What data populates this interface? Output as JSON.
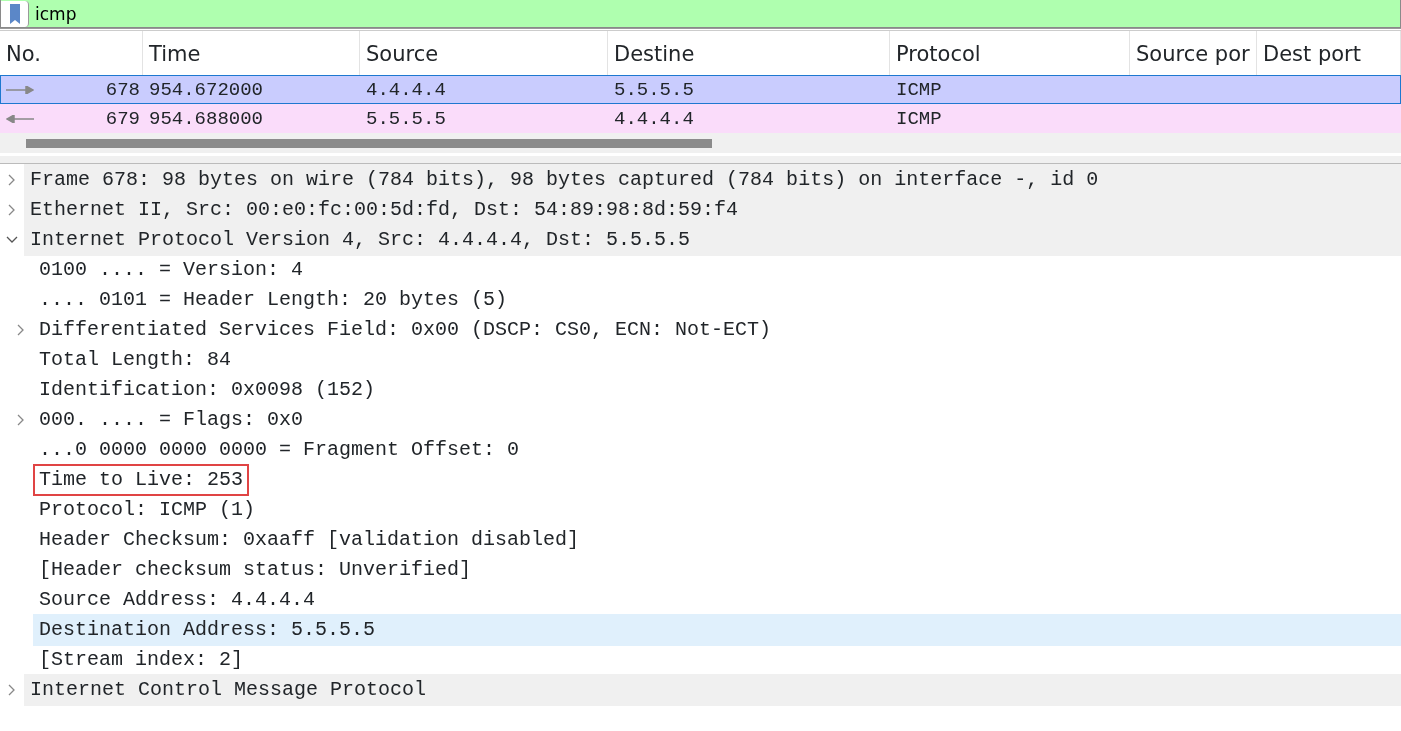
{
  "filter": {
    "value": "icmp"
  },
  "packet_list": {
    "columns": [
      "No.",
      "Time",
      "Source",
      "Destine",
      "Protocol",
      "Source por",
      "Dest port"
    ],
    "rows": [
      {
        "kind": "out",
        "selected": true,
        "color": "#c9ccfe",
        "cells": [
          "678",
          "954.672000",
          "4.4.4.4",
          "5.5.5.5",
          "ICMP",
          "",
          ""
        ]
      },
      {
        "kind": "in",
        "selected": false,
        "color": "#fadcfa",
        "cells": [
          "679",
          "954.688000",
          "5.5.5.5",
          "4.4.4.4",
          "ICMP",
          "",
          ""
        ]
      }
    ]
  },
  "details": [
    {
      "text": "Frame 678: 98 bytes on wire (784 bits), 98 bytes captured (784 bits) on interface -, id 0",
      "expanded": false,
      "selected": false,
      "boxed": false
    },
    {
      "text": "Ethernet II, Src: 00:e0:fc:00:5d:fd, Dst: 54:89:98:8d:59:f4",
      "expanded": false,
      "selected": false,
      "boxed": false
    },
    {
      "text": "Internet Protocol Version 4, Src: 4.4.4.4, Dst: 5.5.5.5",
      "expanded": true,
      "selected": false,
      "boxed": false,
      "children": [
        {
          "text": "0100 .... = Version: 4",
          "selected": false,
          "boxed": false
        },
        {
          "text": ".... 0101 = Header Length: 20 bytes (5)",
          "selected": false,
          "boxed": false
        },
        {
          "text": "Differentiated Services Field: 0x00 (DSCP: CS0, ECN: Not-ECT)",
          "expanded": false,
          "selected": false,
          "boxed": false
        },
        {
          "text": "Total Length: 84",
          "selected": false,
          "boxed": false
        },
        {
          "text": "Identification: 0x0098 (152)",
          "selected": false,
          "boxed": false
        },
        {
          "text": "000. .... = Flags: 0x0",
          "expanded": false,
          "selected": false,
          "boxed": false
        },
        {
          "text": "...0 0000 0000 0000 = Fragment Offset: 0",
          "selected": false,
          "boxed": false
        },
        {
          "text": "Time to Live: 253",
          "selected": false,
          "boxed": true
        },
        {
          "text": "Protocol: ICMP (1)",
          "selected": false,
          "boxed": false
        },
        {
          "text": "Header Checksum: 0xaaff [validation disabled]",
          "selected": false,
          "boxed": false
        },
        {
          "text": "[Header checksum status: Unverified]",
          "selected": false,
          "boxed": false
        },
        {
          "text": "Source Address: 4.4.4.4",
          "selected": false,
          "boxed": false
        },
        {
          "text": "Destination Address: 5.5.5.5",
          "selected": true,
          "boxed": false
        },
        {
          "text": "[Stream index: 2]",
          "selected": false,
          "boxed": false
        }
      ]
    },
    {
      "text": "Internet Control Message Protocol",
      "expanded": false,
      "selected": false,
      "boxed": false
    }
  ]
}
